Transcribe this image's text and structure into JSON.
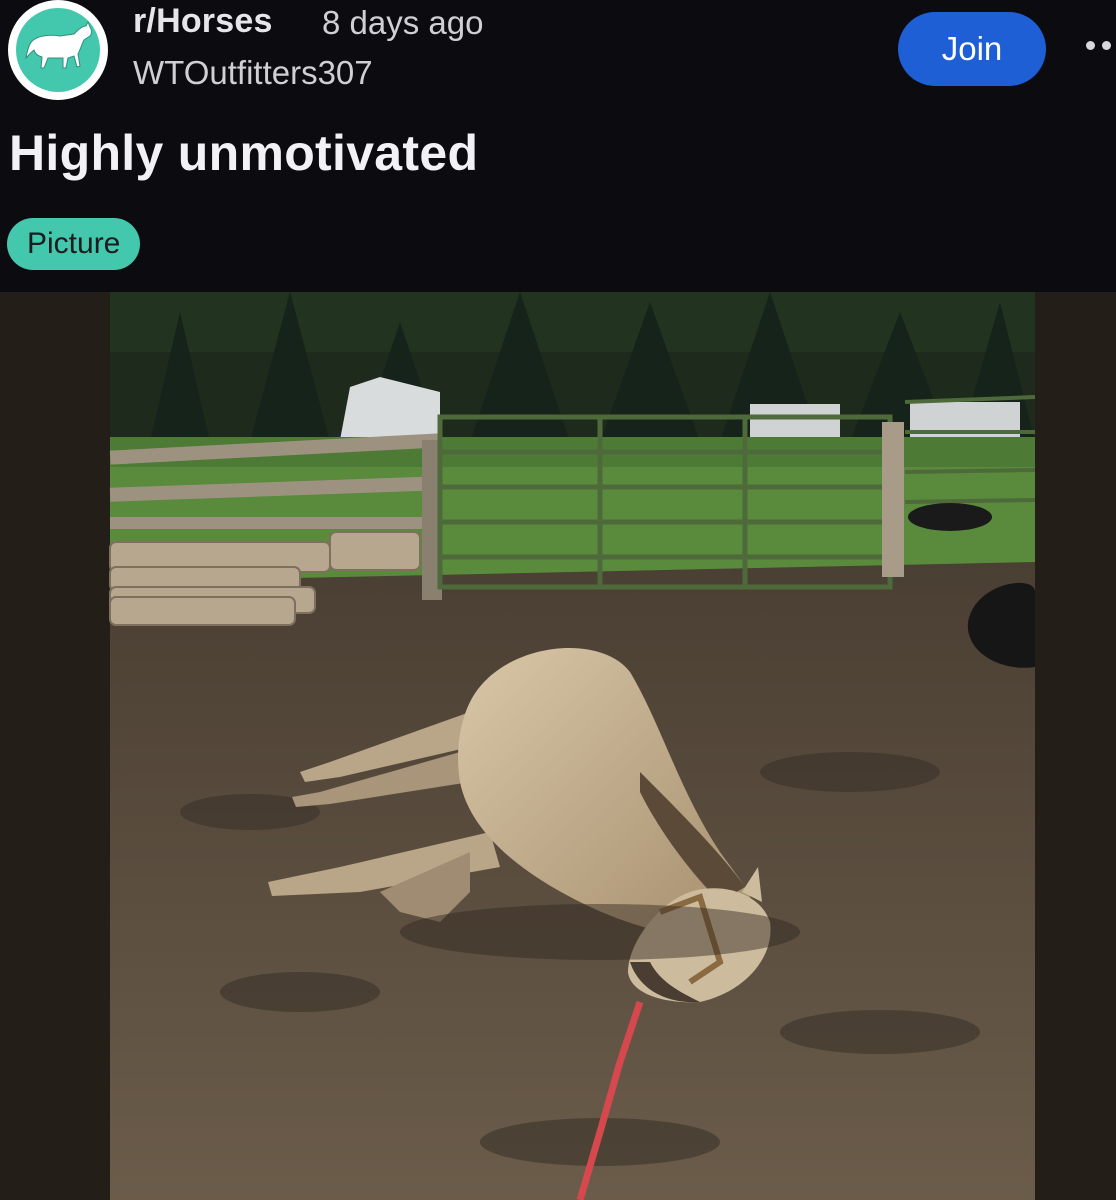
{
  "header": {
    "subreddit": "r/Horses",
    "time_ago": "8 days ago",
    "author": "WTOutfitters307",
    "join_label": "Join",
    "avatar_icon": "horse-icon",
    "more_icon": "more-options-icon"
  },
  "post": {
    "title": "Highly unmotivated",
    "flair": "Picture"
  },
  "colors": {
    "background": "#0b0b10",
    "join_button": "#1f5fd6",
    "flair": "#43c7ad",
    "avatar_ring": "#43c7ad"
  }
}
